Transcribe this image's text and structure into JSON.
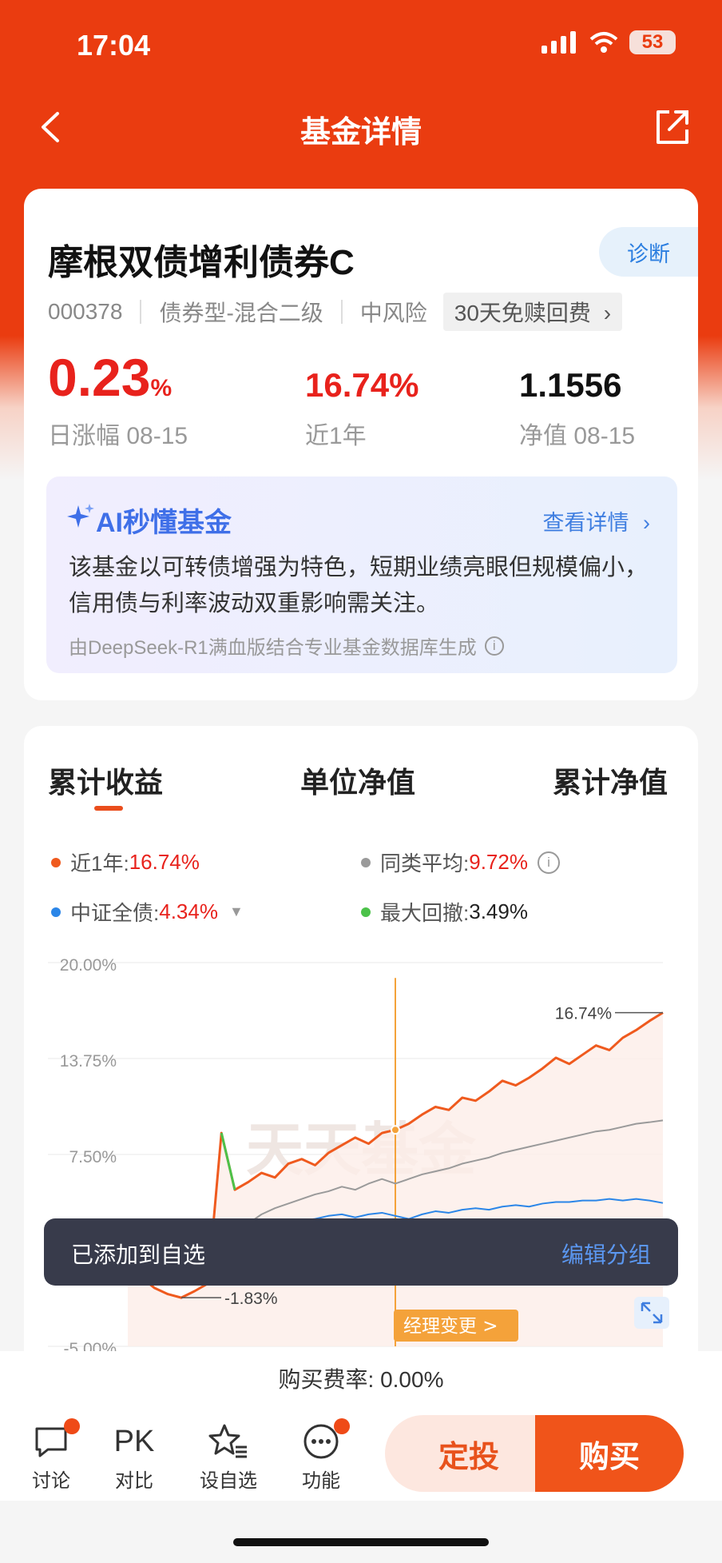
{
  "status": {
    "time": "17:04",
    "battery": "53"
  },
  "nav": {
    "title": "基金详情"
  },
  "fund": {
    "name": "摩根双债增利债券C",
    "diagnose": "诊断",
    "code": "000378",
    "type": "债券型-混合二级",
    "risk": "中风险",
    "promo": "30天免赎回费",
    "daily_change": "0.23",
    "daily_unit": "%",
    "daily_label": "日涨幅 08-15",
    "year_return": "16.74%",
    "year_label": "近1年",
    "nav_value": "1.1556",
    "nav_label": "净值 08-15"
  },
  "ai": {
    "title": "AI秒懂基金",
    "more": "查看详情",
    "text": "该基金以可转债增强为特色，短期业绩亮眼但规模偏小，信用债与利率波动双重影响需关注。",
    "footer": "由DeepSeek-R1满血版结合专业基金数据库生成"
  },
  "chart_tabs": [
    "累计收益",
    "单位净值",
    "累计净值"
  ],
  "legend": [
    {
      "label": "近1年:",
      "value": "16.74%",
      "color": "#ef5a1e"
    },
    {
      "label": "同类平均:",
      "value": "9.72%",
      "color": "#9a9a9a"
    },
    {
      "label": "中证全债:",
      "value": "4.34%",
      "color": "#2b86e8"
    },
    {
      "label": "最大回撤:",
      "value": "3.49%",
      "color": "#4cc24a"
    }
  ],
  "chart_data": {
    "type": "line",
    "y_ticks": [
      "20.00%",
      "13.75%",
      "7.50%",
      "-5.00%"
    ],
    "ylim": [
      -5.0,
      20.0
    ],
    "watermark": "天天基金",
    "end_label": "16.74%",
    "min_label": "-1.83%",
    "event_label": "经理变更 >",
    "series": [
      {
        "name": "近1年",
        "values": [
          0.3,
          -0.5,
          -1.2,
          -1.6,
          -1.83,
          -1.4,
          -0.9,
          8.9,
          5.2,
          5.7,
          6.3,
          6.0,
          6.9,
          7.2,
          6.8,
          7.6,
          8.1,
          8.6,
          8.2,
          8.9,
          9.1,
          9.5,
          10.1,
          10.6,
          10.4,
          11.2,
          11.0,
          11.6,
          12.3,
          12.0,
          12.5,
          13.1,
          13.8,
          13.4,
          14.0,
          14.6,
          14.3,
          15.1,
          15.6,
          16.2,
          16.74
        ]
      },
      {
        "name": "同类平均",
        "values": [
          0.1,
          -0.3,
          -0.8,
          -1.0,
          -0.8,
          -0.4,
          0.2,
          2.0,
          2.5,
          3.0,
          3.6,
          4.0,
          4.3,
          4.6,
          4.9,
          5.1,
          5.4,
          5.2,
          5.6,
          5.9,
          5.6,
          5.9,
          6.2,
          6.4,
          6.6,
          6.9,
          7.1,
          7.3,
          7.6,
          7.8,
          8.0,
          8.2,
          8.4,
          8.6,
          8.8,
          9.0,
          9.1,
          9.3,
          9.5,
          9.6,
          9.72
        ]
      },
      {
        "name": "中证全债",
        "values": [
          0.1,
          0.0,
          -0.2,
          -0.1,
          0.2,
          0.5,
          0.9,
          1.5,
          2.0,
          2.3,
          2.5,
          2.8,
          3.0,
          3.2,
          3.3,
          3.5,
          3.6,
          3.4,
          3.6,
          3.7,
          3.5,
          3.3,
          3.6,
          3.8,
          3.7,
          3.9,
          4.0,
          3.9,
          4.1,
          4.2,
          4.1,
          4.3,
          4.4,
          4.4,
          4.5,
          4.5,
          4.6,
          4.5,
          4.6,
          4.5,
          4.34
        ]
      }
    ]
  },
  "toast": {
    "text": "已添加到自选",
    "action": "编辑分组"
  },
  "fee": {
    "text": "购买费率: 0.00%"
  },
  "bottom": {
    "discuss": "讨论",
    "pk_icon": "PK",
    "pk": "对比",
    "watch": "设自选",
    "func": "功能",
    "sip": "定投",
    "buy": "购买"
  }
}
